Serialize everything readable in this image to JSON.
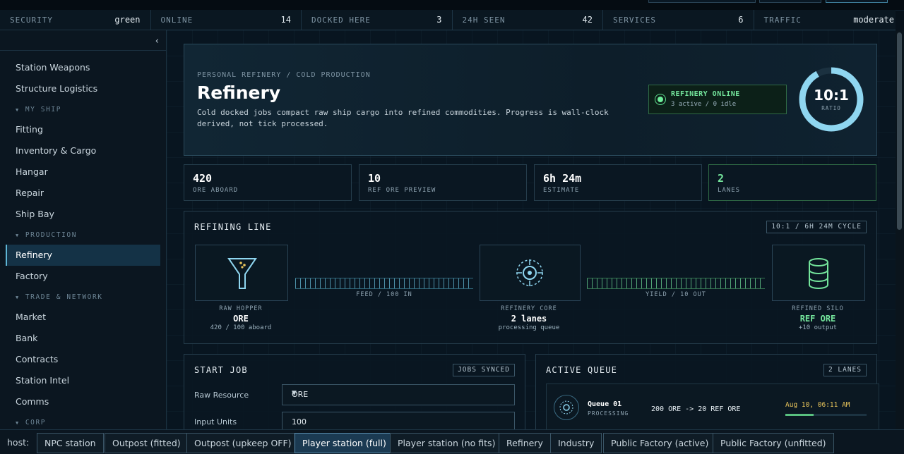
{
  "stats": [
    {
      "key": "SECURITY",
      "value": "green"
    },
    {
      "key": "ONLINE",
      "value": "14"
    },
    {
      "key": "DOCKED HERE",
      "value": "3"
    },
    {
      "key": "24H SEEN",
      "value": "42"
    },
    {
      "key": "SERVICES",
      "value": "6"
    },
    {
      "key": "TRAFFIC",
      "value": "moderate"
    }
  ],
  "sidebar": {
    "collapse_glyph": "‹",
    "items_top": [
      "Station Weapons",
      "Structure Logistics"
    ],
    "sec_myship": "MY SHIP",
    "items_myship": [
      "Fitting",
      "Inventory & Cargo",
      "Hangar",
      "Repair",
      "Ship Bay"
    ],
    "sec_production": "PRODUCTION",
    "items_production": [
      "Refinery",
      "Factory"
    ],
    "sec_trade": "TRADE & NETWORK",
    "items_trade": [
      "Market",
      "Bank",
      "Contracts",
      "Station Intel",
      "Comms"
    ],
    "sec_corp": "CORP",
    "active": "Refinery"
  },
  "hero": {
    "crumb": "PERSONAL REFINERY / COLD PRODUCTION",
    "title": "Refinery",
    "description": "Cold docked jobs compact raw ship cargo into refined commodities. Progress is wall-clock derived, not tick processed.",
    "status_title": "REFINERY ONLINE",
    "status_sub": "3 active / 0 idle",
    "ratio": "10:1",
    "ratio_label": "RATIO",
    "ratio_fill": 0.92
  },
  "kpis": [
    {
      "value": "420",
      "label": "ORE ABOARD"
    },
    {
      "value": "10",
      "label": "REF ORE PREVIEW"
    },
    {
      "value": "6h 24m",
      "label": "ESTIMATE"
    },
    {
      "value": "2",
      "label": "LANES"
    }
  ],
  "line": {
    "title": "REFINING LINE",
    "tag": "10:1 / 6H 24M CYCLE",
    "hopper_label": "RAW HOPPER",
    "hopper_value": "ORE",
    "hopper_sub": "420 / 100 aboard",
    "feed_label": "FEED / 100 IN",
    "core_label": "REFINERY CORE",
    "core_value": "2 lanes",
    "core_sub": "processing queue",
    "yield_label": "YIELD / 10 OUT",
    "silo_label": "REFINED SILO",
    "silo_value": "REF ORE",
    "silo_sub": "+10 output",
    "accent_blue": "#7fd0ea",
    "accent_green": "#74e59c"
  },
  "start_job": {
    "title": "START JOB",
    "tag": "JOBS SYNCED",
    "resource_label": "Raw Resource",
    "resource_value": "ORE",
    "units_label": "Input Units",
    "units_value": "100"
  },
  "queue": {
    "title": "ACTIVE QUEUE",
    "tag": "2 LANES",
    "rows": [
      {
        "name": "Queue 01",
        "status": "PROCESSING",
        "conversion": "200 ORE -> 20 REF ORE",
        "eta": "Aug 10, 06:11 AM",
        "progress": 0.35
      }
    ]
  },
  "host": {
    "label": "host:",
    "buttons": [
      "NPC station",
      "Outpost (fitted)",
      "Outpost (upkeep OFF)",
      "Player station (full)",
      "Player station (no fits)",
      "Refinery",
      "Industry",
      "Public Factory (active)",
      "Public Factory (unfitted)"
    ],
    "active": "Player station (full)"
  }
}
